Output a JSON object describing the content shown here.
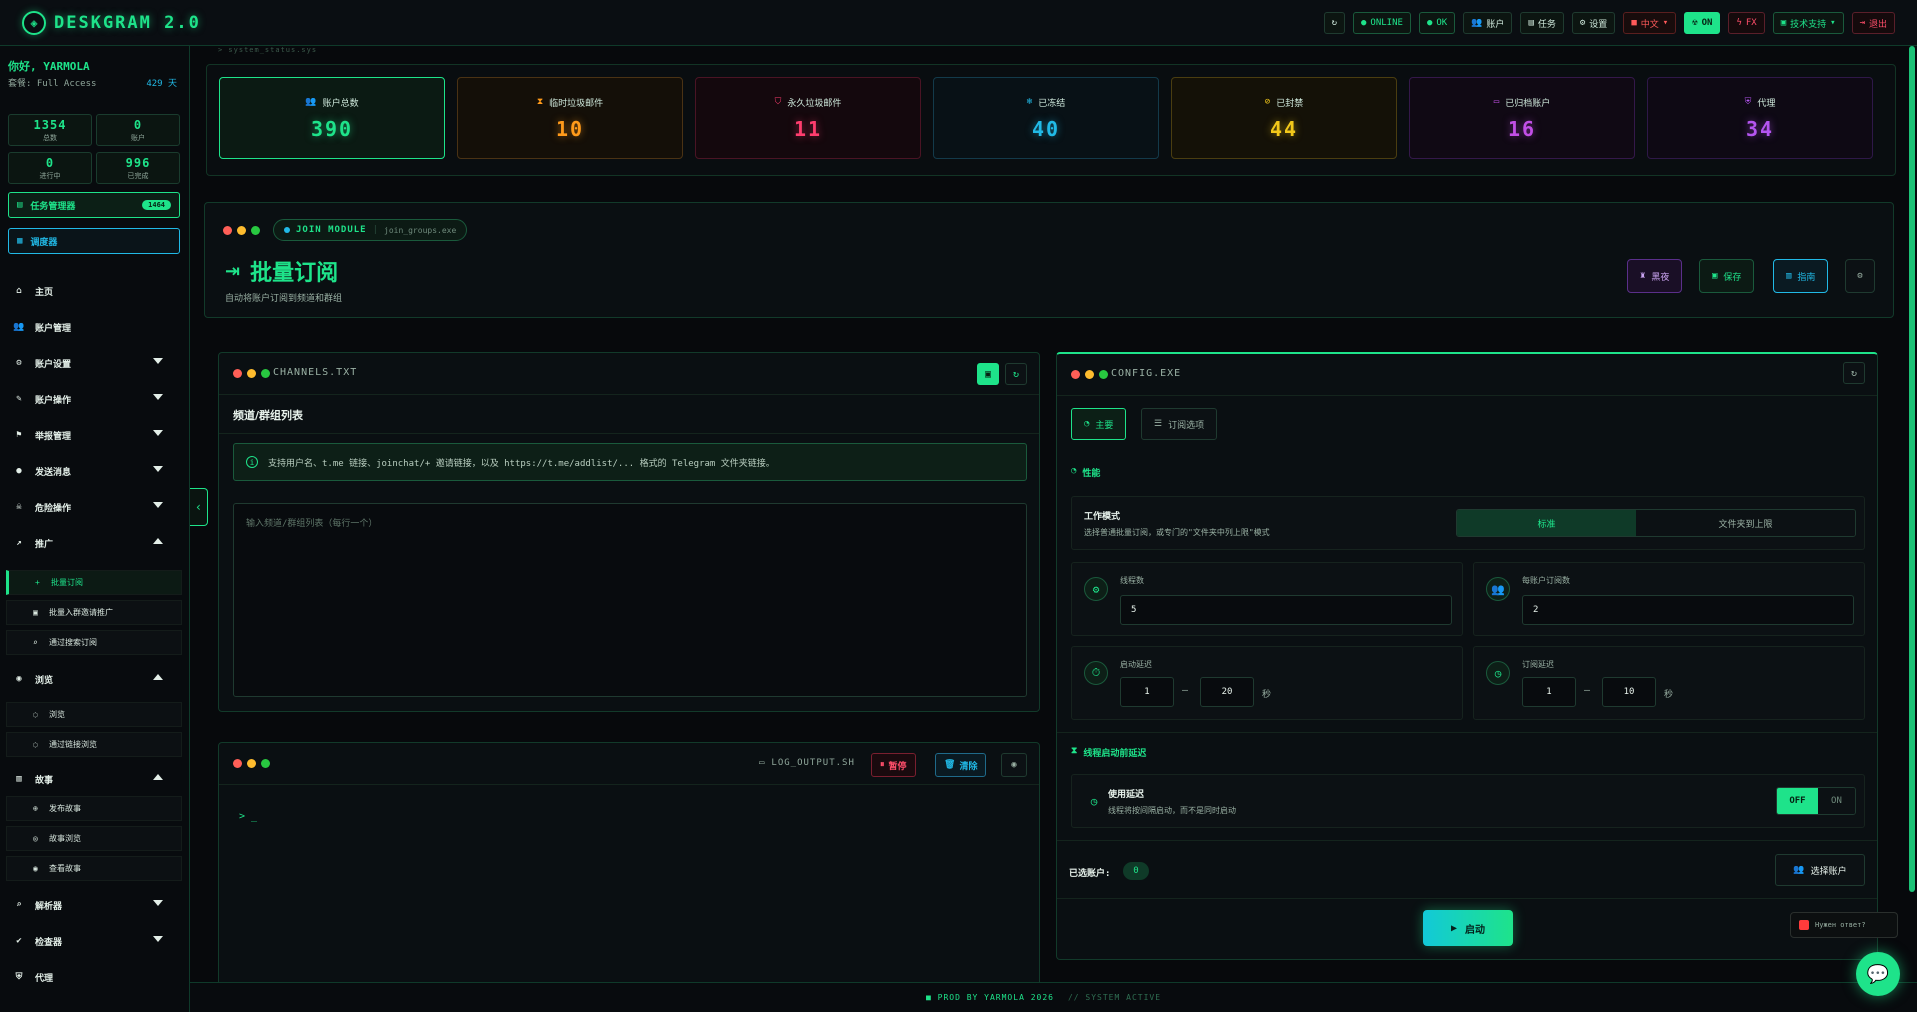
{
  "app": {
    "title": "DESKGRAM 2.0",
    "accent": "#1ee38a"
  },
  "topbar": {
    "online": "ONLINE",
    "ok": "OK",
    "accounts": "账户",
    "tasks": "任务",
    "settings": "设置",
    "language": "中文",
    "on": "ON",
    "fx": "FX",
    "tech": "技术支持",
    "logout": "退出"
  },
  "sidebar": {
    "greeting": "你好, YARMOLA",
    "plan": "套餐: Full Access",
    "days": "429 天",
    "stats": [
      {
        "value": "1354",
        "label": "总数"
      },
      {
        "value": "0",
        "label": "账户"
      },
      {
        "value": "0",
        "label": "进行中"
      },
      {
        "value": "996",
        "label": "已完成"
      }
    ],
    "task_manager": "任务管理器",
    "task_badge": "1464",
    "calendar": "调度器",
    "nav": [
      {
        "label": "主页"
      },
      {
        "label": "账户管理"
      },
      {
        "label": "账户设置"
      },
      {
        "label": "账户操作"
      },
      {
        "label": "举报管理"
      },
      {
        "label": "发送消息"
      },
      {
        "label": "危险操作"
      },
      {
        "label": "推广"
      }
    ],
    "promo_sub": [
      {
        "label": "批量订阅"
      },
      {
        "label": "批量入群邀请推广"
      },
      {
        "label": "通过搜索订阅"
      }
    ],
    "view_group": "浏览",
    "view_sub": [
      {
        "label": "浏览"
      },
      {
        "label": "通过链接浏览"
      }
    ],
    "story_group": "故事",
    "story_sub": [
      {
        "label": "发布故事"
      },
      {
        "label": "故事浏览"
      },
      {
        "label": "查看故事"
      }
    ],
    "nav_bottom": [
      {
        "label": "解析器"
      },
      {
        "label": "检查器"
      },
      {
        "label": "代理"
      }
    ]
  },
  "main": {
    "path": "> system_status.sys",
    "kpis": [
      {
        "label": "账户总数",
        "value": "390",
        "color": "#1ee38a"
      },
      {
        "label": "临时垃圾邮件",
        "value": "10",
        "color": "#ff9a1a"
      },
      {
        "label": "永久垃圾邮件",
        "value": "11",
        "color": "#ff3d6e"
      },
      {
        "label": "已冻结",
        "value": "40",
        "color": "#21b9e6"
      },
      {
        "label": "已封禁",
        "value": "44",
        "color": "#f2c81a"
      },
      {
        "label": "已归档账户",
        "value": "16",
        "color": "#c24fe6"
      },
      {
        "label": "代理",
        "value": "34",
        "color": "#b455f0"
      }
    ],
    "module": {
      "name": "JOIN MODULE",
      "file": "join_groups.exe",
      "title": "批量订阅",
      "desc": "自动将账户订阅到频道和群组",
      "btn_history": "黑夜",
      "btn_save": "保存",
      "btn_guide": "指南"
    },
    "channels": {
      "file": "CHANNELS.TXT",
      "title": "频道/群组列表",
      "info": "支持用户名、t.me 链接、joinchat/+ 邀请链接，以及 https://t.me/addlist/... 格式的 Telegram 文件夹链接。",
      "placeholder": "输入频道/群组列表（每行一个）"
    },
    "log": {
      "file": "LOG_OUTPUT.SH",
      "pause": "暂停",
      "clear": "清除",
      "prompt": "> _"
    },
    "config": {
      "file": "CONFIG.EXE",
      "tab_main": "主要",
      "tab_sub": "订阅选项",
      "section": "性能",
      "mode_title": "工作模式",
      "mode_desc": "选择普通批量订阅，或专门的\"文件夹中列上限\"模式",
      "mode_a": "标准",
      "mode_b": "文件夹到上限",
      "threads_label": "线程数",
      "threads_value": "5",
      "per_acc_label": "每账户订阅数",
      "per_acc_value": "2",
      "start_delay_label": "启动延迟",
      "start_min": "1",
      "start_max": "20",
      "sub_delay_label": "订阅延迟",
      "sub_min": "1",
      "sub_max": "10",
      "unit": "秒",
      "dash": "—",
      "pre_section": "线程启动前延迟",
      "use_delay_title": "使用延迟",
      "use_delay_desc": "线程将按间隔启动，而不是同时启动",
      "off": "OFF",
      "on": "ON",
      "selected_label": "已选账户:",
      "selected_count": "0",
      "select_btn": "选择账户",
      "launch": "启动"
    },
    "footer_left": "■ PROD BY YARMOLA 2026",
    "footer_right": "// SYSTEM ACTIVE",
    "toast": "Нужен ответ?"
  }
}
